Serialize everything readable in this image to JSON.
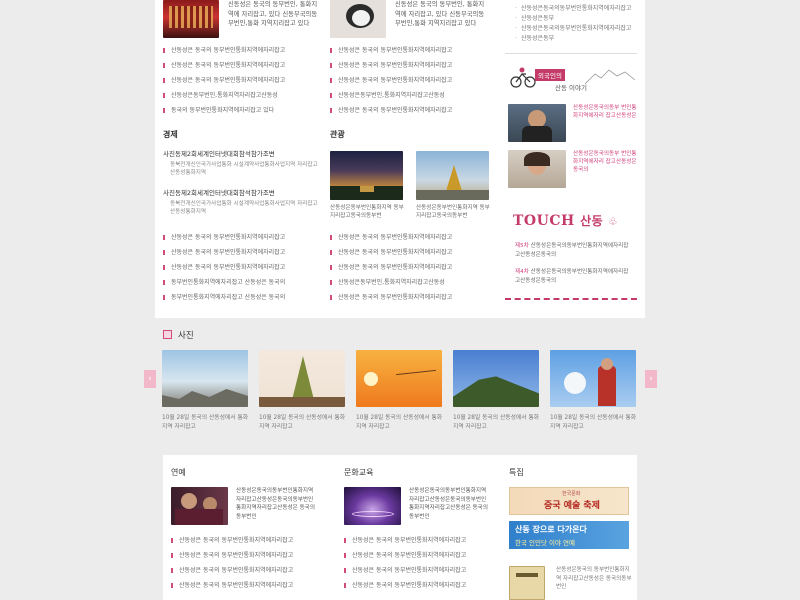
{
  "top": {
    "lead_left": {
      "text": "신동성은 동국의 동부번인, 통화지역에 자리잡고, 있다 신동무국의동부번인,통화 지역지리잡고 있다"
    },
    "lead_middle": {
      "text": "신동성은 동국의 동부번인, 통화지역에 자리잡고, 있다 신동무국의동부번인,통화 지역지리잡고 있다"
    },
    "list_left": [
      "산동성은 동국의 동부번인통화지역에자리잡고",
      "산동성은 동국의 동부번인통화지역에자리잡고",
      "산동성은 동국의 동부번인통화지역에자리잡고",
      "산동성은동부번인,통화지역자리잡고산동성",
      "동국의 동부번인통화지역에자리잡고 있다"
    ],
    "list_middle": [
      "산동성은 동국의 동부번인통화지역에자리잡고",
      "산동성은 동국의 동부번인통화지역에자리잡고",
      "산동성은 동국의 동부번인통화지역에자리잡고",
      "산동성은동부번인,통화지역자리잡고산동성",
      "산동성은 동국의 동부번인통화지역에자리잡고"
    ],
    "economy": {
      "title": "경제",
      "item1_title": "사진동제2회세계인터넷대회참석참가조변",
      "item1_text": "동북전개신인국가사업통화 시설계약사업통화사업지역 자리잡고산동성통화지역",
      "item2_title": "사진동제2회세계인터넷대회참석참가조변",
      "item2_text": "동북전개신인국가사업통화 시설계약사업통화사업지역 자리잡고산동성통화지역",
      "list": [
        "산동성은 동국의 동부번인통화지역에자리잡고",
        "산동성은 동국의 동부번인통화지역에자리잡고",
        "산동성은 동국의 동부번인통화지역에자리잡고",
        "동부번인통화지역에자리잡고 산동성은 동국의",
        "동부번인통화지역에자리잡고 산동성은 동국의"
      ]
    },
    "tourism": {
      "title": "관광",
      "cap1": "산동성은동부번인통화지역 동부지리잡고동국의동부번",
      "cap2": "산동성은동부번인통화지역 동부지리잡고동국의동부번",
      "list": [
        "산동성은 동국의 동부번인통화지역에자리잡고",
        "산동성은 동국의 동부번인통화지역에자리잡고",
        "산동성은 동국의 동부번인통화지역에자리잡고",
        "산동성은동부번인,통화지역자리잡고산동성",
        "산동성은 동국의 동부번인통화지역에자리잡고"
      ]
    }
  },
  "sidebar": {
    "top_list": [
      "산동성은동국의동부번인통화지역에자리잡고",
      "산동성은동부",
      "산동성은동국의동부번인통화지역에자리잡고",
      "산동성은동부"
    ],
    "foreigner": {
      "badge": "외국인의",
      "subtitle": "산동 이야기",
      "item1_text": "산동성은동국의동부 번인통화지역에자리 잡고산동성은",
      "item2_text": "산동성은동국의동부 번인통화지역에자리 잡고산동성은동국의"
    },
    "touch": {
      "logo_en": "TOUCH",
      "logo_ko": "산동",
      "items": [
        {
          "num": "제5차",
          "text": "산동성은동국의동부번인통화지역에자리잡고산동성은동국의"
        },
        {
          "num": "제4차",
          "text": "산동성은동국의동부번인통화지역에자리잡고산동성은동국의"
        }
      ]
    }
  },
  "photos": {
    "title": "사진",
    "prev": "‹",
    "next": "›",
    "captions": [
      "10월 28일 동국의 산동성에서 통화지역 자리잡고",
      "10월 28일 동국의 산동성에서 통화지역 자리잡고",
      "10월 28일 동국의 산동성에서 통화지역 자리잡고",
      "10월 28일 동국의 산동성에서 통화지역 자리잡고",
      "10월 28일 동국의 산동성에서 통화지역 자리잡고"
    ]
  },
  "bottom": {
    "ent": {
      "title": "연예",
      "lead": "산동성은동국의동부번인통화지역 자리잡고산동성은동국의동부번인 통화지역자리잡고산동성은 동국의 동부번인",
      "list": [
        "산동성은 동국의 동부번인통화지역에자리잡고",
        "산동성은 동국의 동부번인통화지역에자리잡고",
        "산동성은 동국의 동부번인통화지역에자리잡고",
        "산동성은 동국의 동부번인통화지역에자리잡고"
      ]
    },
    "culture": {
      "title": "문화교육",
      "lead": "산동성은동국의동부번인통화지역 자리잡고산동성은동국의동부번인 통화지역자리잡고산동성은 동국의 동부번인",
      "list": [
        "산동성은 동국의 동부번인통화지역에자리잡고",
        "산동성은 동국의 동부번인통화지역에자리잡고",
        "산동성은 동국의 동부번인통화지역에자리잡고",
        "산동성은 동국의 동부번인통화지역에자리잡고"
      ]
    },
    "special": {
      "title": "특집",
      "banner1_small": "한국문화",
      "banner1": "중국 예술 축제",
      "banner2_line1": "산동 장으로 다가온다",
      "banner2_line2": "한국 인민닷 이야 연예",
      "side_text": "산동성은동국의 동부번인통화지역 자리잡고산동성은 동국의동부번인"
    }
  }
}
